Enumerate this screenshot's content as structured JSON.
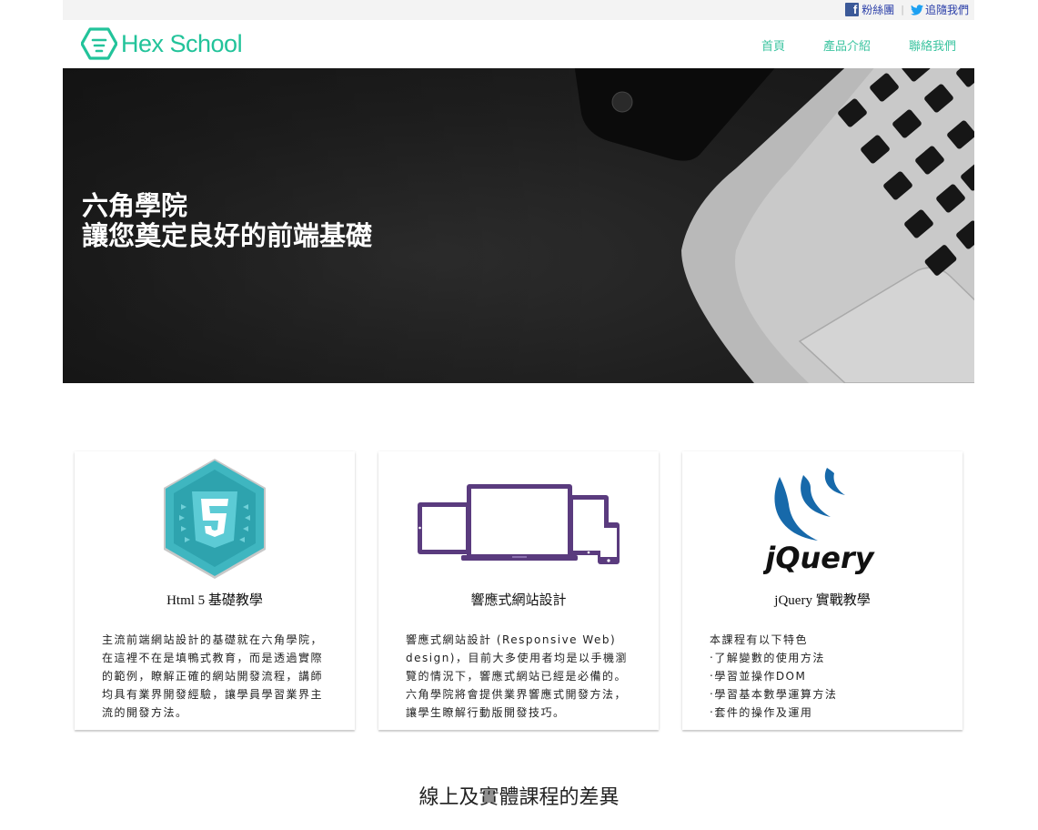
{
  "topbar": {
    "fan_page_label": "粉絲團",
    "follow_label": "追隨我們"
  },
  "header": {
    "logo_text": "Hex School",
    "nav": [
      {
        "label": "首頁"
      },
      {
        "label": "產品介紹"
      },
      {
        "label": "聯絡我們"
      }
    ]
  },
  "hero": {
    "title_line1": "六角學院",
    "title_line2": "讓您奠定良好的前端基礎"
  },
  "cards": [
    {
      "title": "Html 5 基礎教學",
      "body": "主流前端網站設計的基礎就在六角學院，在這裡不在是填鴨式教育，而是透過實際的範例，瞭解正確的網站開發流程，講師均具有業界開發經驗，讓學員學習業界主流的開發方法。"
    },
    {
      "title": "響應式網站設計",
      "body": "響應式網站設計 (Responsive Web) design)，目前大多使用者均是以手機瀏覽的情況下，響應式網站已經是必備的。六角學院將會提供業界響應式開發方法，讓學生瞭解行動版開發技巧。"
    },
    {
      "title": "jQuery 實戰教學",
      "intro": "本課程有以下特色",
      "features": [
        "‧了解變數的使用方法",
        "‧學習並操作DOM",
        "‧學習基本數學運算方法",
        "‧套件的操作及運用"
      ]
    }
  ],
  "section": {
    "title": "線上及實體課程的差異"
  },
  "icons": {
    "facebook": "facebook-icon",
    "twitter": "twitter-icon",
    "logo": "hex-logo-icon"
  },
  "colors": {
    "brand": "#22c39a",
    "nav": "#3cc4a0"
  }
}
